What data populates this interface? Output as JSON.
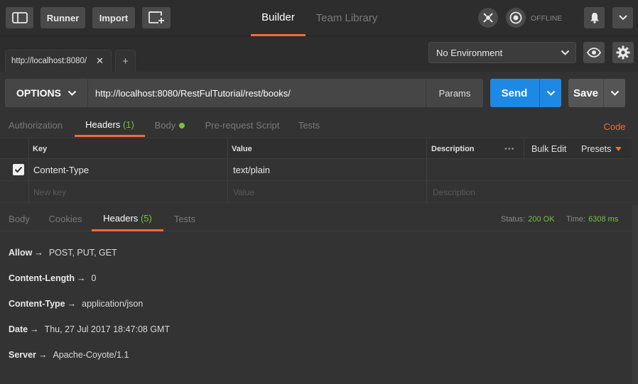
{
  "topbar": {
    "runner": "Runner",
    "import": "Import",
    "tabs": {
      "builder": "Builder",
      "team_library": "Team Library"
    },
    "offline": "OFFLINE"
  },
  "request_tab": {
    "title": "http://localhost:8080/",
    "close": "✕",
    "new_tab": "+"
  },
  "environment": {
    "selected": "No Environment"
  },
  "request": {
    "method": "OPTIONS",
    "url": "http://localhost:8080/RestFulTutorial/rest/books/",
    "params_label": "Params",
    "send_label": "Send",
    "save_label": "Save"
  },
  "request_tabs": {
    "authorization": "Authorization",
    "headers": "Headers",
    "headers_count": "(1)",
    "body": "Body",
    "prerequest": "Pre-request Script",
    "tests": "Tests",
    "code": "Code"
  },
  "headers_table": {
    "columns": {
      "key": "Key",
      "value": "Value",
      "description": "Description"
    },
    "more": "•••",
    "bulk_edit": "Bulk Edit",
    "presets": "Presets",
    "rows": [
      {
        "key": "Content-Type",
        "value": "text/plain",
        "description": "",
        "checked": true
      }
    ],
    "placeholders": {
      "key": "New key",
      "value": "Value",
      "description": "Description"
    }
  },
  "response": {
    "tabs": {
      "body": "Body",
      "cookies": "Cookies",
      "headers": "Headers",
      "headers_count": "(5)",
      "tests": "Tests"
    },
    "status_label": "Status:",
    "status_value": "200 OK",
    "time_label": "Time:",
    "time_value": "6308 ms",
    "headers": [
      {
        "key": "Allow",
        "value": "POST, PUT, GET"
      },
      {
        "key": "Content-Length",
        "value": "0"
      },
      {
        "key": "Content-Type",
        "value": "application/json"
      },
      {
        "key": "Date",
        "value": "Thu, 27 Jul 2017 18:47:08 GMT"
      },
      {
        "key": "Server",
        "value": "Apache-Coyote/1.1"
      }
    ],
    "arrow": "→"
  },
  "colors": {
    "accent": "#f26b3a",
    "send": "#1e88e5",
    "status_ok": "#78c13c",
    "background": "#333333"
  },
  "icons": [
    "sidebar-toggle-icon",
    "new-window-icon",
    "sync-icon",
    "offline-icon",
    "bell-icon",
    "chevron-down-icon",
    "eye-icon",
    "gear-icon",
    "checkbox-icon",
    "caret-down-icon"
  ]
}
